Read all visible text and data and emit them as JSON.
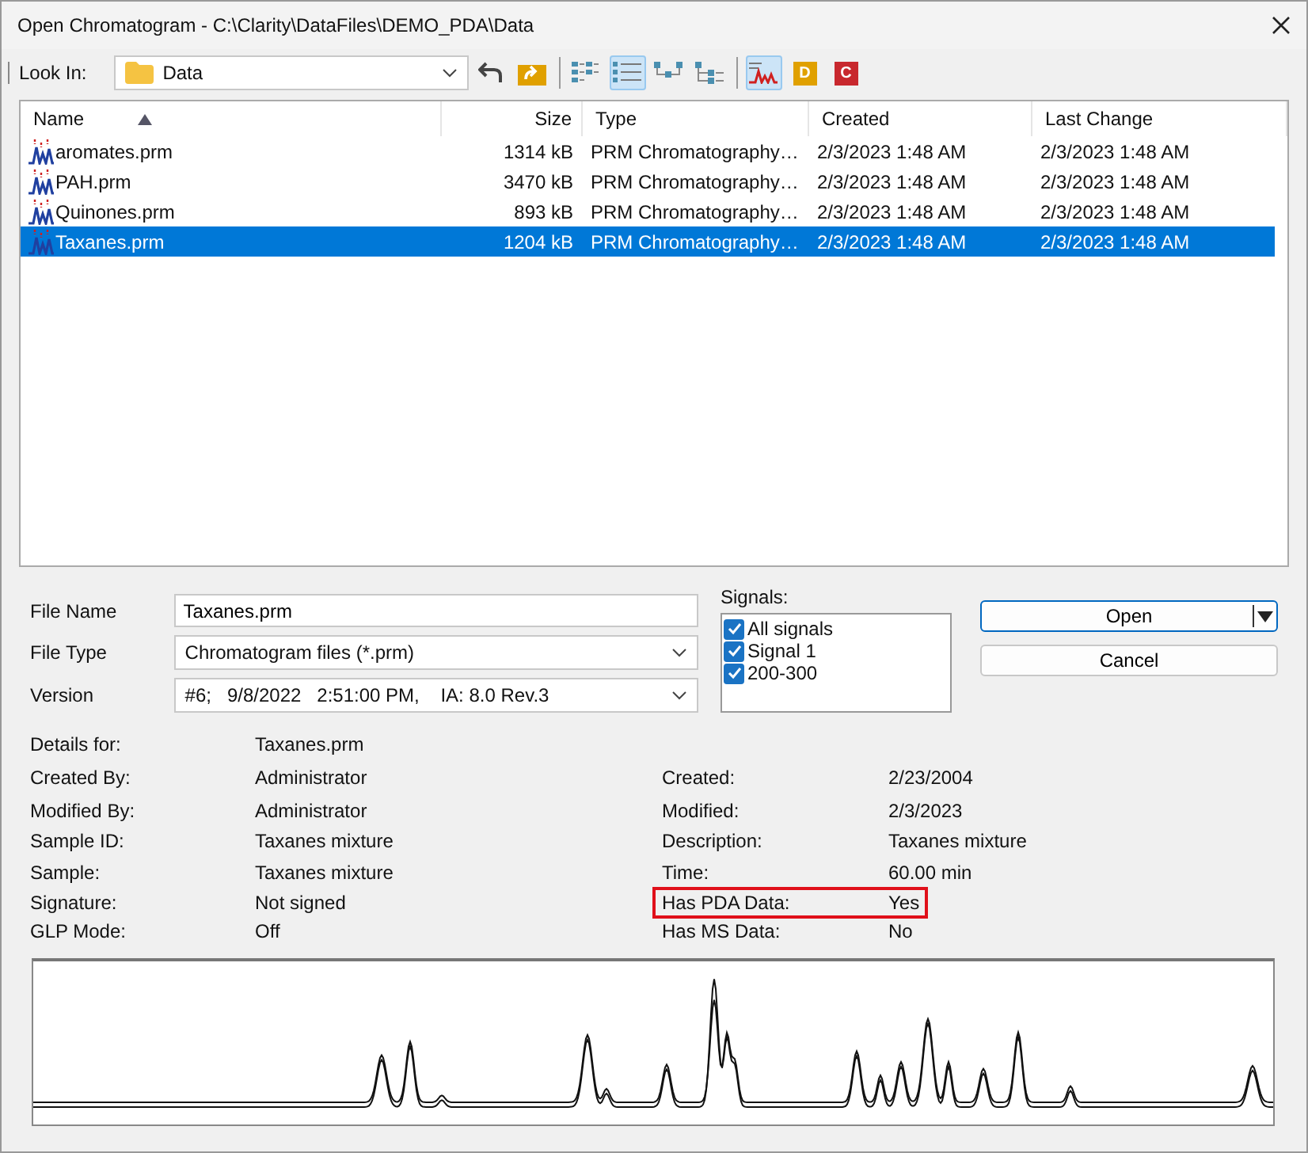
{
  "window": {
    "title": "Open Chromatogram - C:\\Clarity\\DataFiles\\DEMO_PDA\\Data"
  },
  "toolbar": {
    "look_in_label": "Look In:",
    "folder": "Data",
    "buttons": [
      {
        "kind": "back",
        "selected": false
      },
      {
        "kind": "up",
        "selected": false
      },
      {
        "kind": "view-list",
        "selected": false
      },
      {
        "kind": "view-details",
        "selected": true
      },
      {
        "kind": "view-tree",
        "selected": false
      },
      {
        "kind": "view-tree2",
        "selected": false
      },
      {
        "kind": "chromatogram",
        "selected": true
      },
      {
        "kind": "letter",
        "text": "D",
        "color": "#e0a000",
        "selected": false
      },
      {
        "kind": "letter",
        "text": "C",
        "color": "#c8282e",
        "selected": false
      }
    ]
  },
  "table": {
    "columns": [
      {
        "label": "Name",
        "sorted": true
      },
      {
        "label": "Size",
        "sorted": false
      },
      {
        "label": "Type",
        "sorted": false
      },
      {
        "label": "Created",
        "sorted": false
      },
      {
        "label": "Last Change",
        "sorted": false
      }
    ],
    "rows": [
      {
        "name": "aromates.prm",
        "size": "1314 kB",
        "type": "PRM Chromatography…",
        "created": "2/3/2023 1:48 AM",
        "last_change": "2/3/2023 1:48 AM",
        "selected": false
      },
      {
        "name": "PAH.prm",
        "size": "3470 kB",
        "type": "PRM Chromatography…",
        "created": "2/3/2023 1:48 AM",
        "last_change": "2/3/2023 1:48 AM",
        "selected": false
      },
      {
        "name": "Quinones.prm",
        "size": "893 kB",
        "type": "PRM Chromatography…",
        "created": "2/3/2023 1:48 AM",
        "last_change": "2/3/2023 1:48 AM",
        "selected": false
      },
      {
        "name": "Taxanes.prm",
        "size": "1204 kB",
        "type": "PRM Chromatography…",
        "created": "2/3/2023 1:48 AM",
        "last_change": "2/3/2023 1:48 AM",
        "selected": true
      }
    ]
  },
  "form": {
    "fields": [
      {
        "label": "File Name",
        "kind": "text",
        "value": "Taxanes.prm"
      },
      {
        "label": "File Type",
        "kind": "dropdown",
        "value": "Chromatogram files (*.prm)"
      },
      {
        "label": "Version",
        "kind": "dropdown",
        "value": "#6;   9/8/2022   2:51:00 PM,    IA: 8.0 Rev.3"
      }
    ],
    "signals_label": "Signals:",
    "signals": [
      {
        "label": "All signals",
        "checked": true
      },
      {
        "label": "Signal 1",
        "checked": true
      },
      {
        "label": "200-300",
        "checked": true
      }
    ],
    "buttons": [
      {
        "label": "Open",
        "kind": "split"
      },
      {
        "label": "Cancel",
        "kind": "plain"
      }
    ]
  },
  "details": {
    "left": [
      {
        "label": "Details for:",
        "value": "Taxanes.prm"
      },
      {
        "label": "Created By:",
        "value": "Administrator"
      },
      {
        "label": "Modified By:",
        "value": "Administrator"
      },
      {
        "label": "Sample ID:",
        "value": "Taxanes mixture"
      },
      {
        "label": "Sample:",
        "value": "Taxanes mixture"
      },
      {
        "label": "Signature:",
        "value": "Not signed"
      },
      {
        "label": "GLP Mode:",
        "value": "Off"
      }
    ],
    "right": [
      {
        "label": "Created:",
        "value": "2/23/2004",
        "highlighted": false
      },
      {
        "label": "Modified:",
        "value": "2/3/2023",
        "highlighted": false
      },
      {
        "label": "Description:",
        "value": "Taxanes mixture",
        "highlighted": false
      },
      {
        "label": "Time:",
        "value": "60.00 min",
        "highlighted": false
      },
      {
        "label": "Has PDA Data:",
        "value": "Yes",
        "highlighted": true
      },
      {
        "label": "Has MS Data:",
        "value": "No",
        "highlighted": false
      }
    ]
  }
}
